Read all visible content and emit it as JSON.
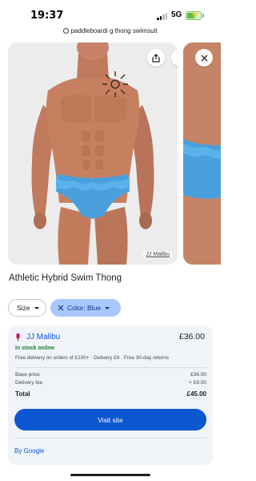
{
  "status_bar": {
    "time": "19:37",
    "network": "5G",
    "battery_level": 0.65,
    "signal_bars": 2
  },
  "search": {
    "query": "paddleboardi g thong swimsuit"
  },
  "image_viewer": {
    "watermark_label": "JJ Malibu"
  },
  "product": {
    "title": "Athletic Hybrid Swim Thong"
  },
  "filters": {
    "size_label": "Size",
    "color_label": "Color: Blue"
  },
  "offer": {
    "merchant": "JJ Malibu",
    "price": "£36.00",
    "stock_status": "In stock online",
    "delivery_note": "Free delivery on orders of £100+ · Delivery £9 · Free 30-day returns",
    "breakdown": [
      {
        "label": "Base price",
        "value": "£36.00"
      },
      {
        "label": "Delivery fee",
        "value": "+ £9.00"
      }
    ],
    "total_label": "Total",
    "total_value": "£45.00",
    "visit_label": "Visit site",
    "by_google": "By Google"
  },
  "colors": {
    "accent": "#0b57d0",
    "chip_selected": "#a8c7fa",
    "in_stock": "#188038",
    "card_bg": "#f0f4f9",
    "swimsuit_blue": "#4aa0dd",
    "battery_green": "#5cbe3e"
  }
}
